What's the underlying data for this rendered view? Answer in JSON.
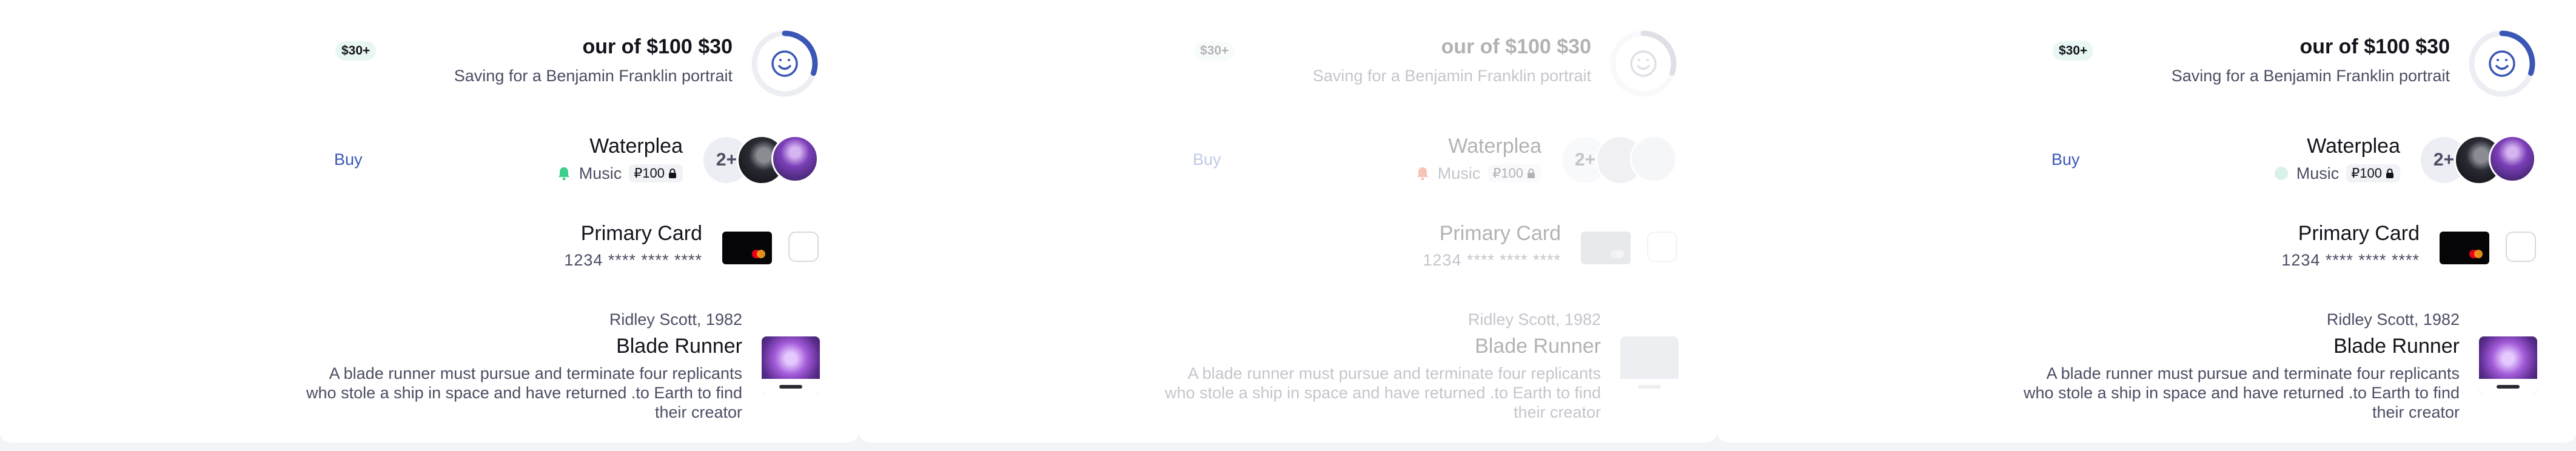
{
  "panels": [
    {
      "savings": {
        "badge": "$30+",
        "title": "our of $100 $30",
        "subtitle": "Saving for a Benjamin Franklin portrait",
        "progress_fraction": 0.3,
        "icon": "smile-icon"
      },
      "music": {
        "buy_label": "Buy",
        "title": "Waterplea",
        "tag_label": "Music",
        "tag_icon": "bell-icon",
        "tag_color": "#3ccf8c",
        "price": "₽100",
        "more_count": "2+"
      },
      "card": {
        "title": "Primary Card",
        "number": "1234 **** **** ****"
      },
      "film": {
        "credit": "Ridley Scott, 1982",
        "title": "Blade Runner",
        "description": "A blade runner must pursue and terminate four replicants who stole a ship in space and have returned .to Earth to find their creator"
      }
    },
    {
      "savings": {
        "badge": "$30+",
        "title": "our of $100 $30",
        "subtitle": "Saving for a Benjamin Franklin portrait",
        "progress_fraction": 0.3,
        "icon": "smile-icon"
      },
      "music": {
        "buy_label": "Buy",
        "title": "Waterplea",
        "tag_label": "Music",
        "tag_icon": "bell-icon",
        "tag_color": "#e5481e",
        "price": "₽100",
        "more_count": "2+"
      },
      "card": {
        "title": "Primary Card",
        "number": "1234 **** **** ****"
      },
      "film": {
        "credit": "Ridley Scott, 1982",
        "title": "Blade Runner",
        "description": "A blade runner must pursue and terminate four replicants who stole a ship in space and have returned .to Earth to find their creator"
      }
    },
    {
      "savings": {
        "badge": "$30+",
        "title": "our of $100 $30",
        "subtitle": "Saving for a Benjamin Franklin portrait",
        "progress_fraction": 0.3,
        "icon": "smile-icon"
      },
      "music": {
        "buy_label": "Buy",
        "title": "Waterplea",
        "tag_label": "Music",
        "tag_icon": "bell-icon",
        "tag_color": "#d9f2e8",
        "price": "₽100",
        "more_count": "2+"
      },
      "card": {
        "title": "Primary Card",
        "number": "1234 **** **** ****"
      },
      "film": {
        "credit": "Ridley Scott, 1982",
        "title": "Blade Runner",
        "description": "A blade runner must pursue and terminate four replicants who stole a ship in space and have returned .to Earth to find their creator"
      }
    }
  ],
  "colors": {
    "accent": "#3b57b5",
    "badge_bg": "#e9f7f3",
    "text_primary": "#13141c",
    "text_secondary": "#4b4e63"
  }
}
